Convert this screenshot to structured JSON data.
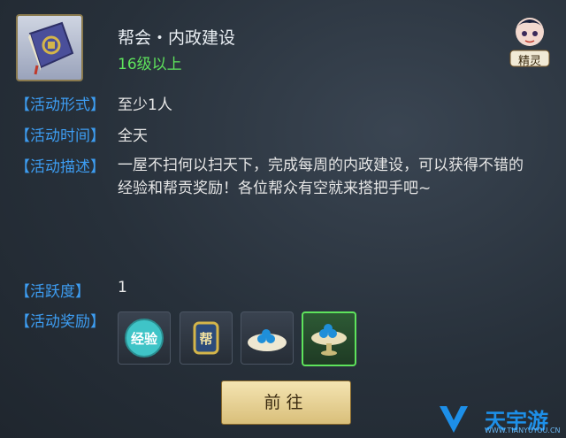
{
  "activity": {
    "title": "帮会・内政建设",
    "level": "16级以上"
  },
  "spirit_button": {
    "label": "精灵",
    "icon": "fairy-avatar-icon"
  },
  "details": {
    "form": {
      "label": "【活动形式】",
      "value": "至少1人"
    },
    "time": {
      "label": "【活动时间】",
      "value": "全天"
    },
    "desc": {
      "label": "【活动描述】",
      "value": "一屋不扫何以扫天下，完成每周的内政建设，可以获得不错的经验和帮贡奖励！各位帮众有空就来搭把手吧~"
    },
    "activity": {
      "label": "【活跃度】",
      "value": "1"
    },
    "rewards": {
      "label": "【活动奖励】"
    }
  },
  "rewards": [
    {
      "icon": "experience-orb-icon",
      "text": "经验"
    },
    {
      "icon": "guild-badge-icon",
      "text": "帮"
    },
    {
      "icon": "blue-gems-plate-icon"
    },
    {
      "icon": "blue-gems-bowl-icon",
      "selected": true
    }
  ],
  "go_button": {
    "label": "前往"
  },
  "watermark": {
    "title": "天宇游",
    "url": "WWW.TIANYUYOU.CN"
  },
  "colors": {
    "label": "#3d9df2",
    "level": "#5ee35c",
    "text": "#e6e6e6"
  }
}
